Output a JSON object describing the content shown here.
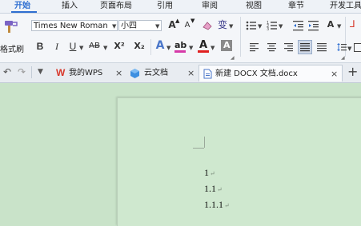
{
  "menu": {
    "tabs": [
      {
        "label": "开始",
        "active": true
      },
      {
        "label": "插入"
      },
      {
        "label": "页面布局"
      },
      {
        "label": "引用"
      },
      {
        "label": "审阅"
      },
      {
        "label": "视图"
      },
      {
        "label": "章节"
      },
      {
        "label": "开发工具"
      }
    ]
  },
  "ribbon": {
    "format_painter_label": "格式刷",
    "font_name": "Times New Roman",
    "font_size": "小四",
    "grow_font": "A",
    "shrink_font": "A",
    "pinyin": "变",
    "bold": "B",
    "italic": "I",
    "underline": "U",
    "strikethrough": "AB",
    "superscript": "X²",
    "subscript": "X₂",
    "text_effect": "A",
    "highlight": "ab",
    "font_color": "A",
    "char_shading": "A",
    "text_dir": "A"
  },
  "tabbar": {
    "tabs": [
      {
        "label": "我的WPS",
        "icon": "wps-logo-icon"
      },
      {
        "label": "云文档",
        "icon": "cloud-docs-icon"
      },
      {
        "label": "新建 DOCX 文档.docx",
        "icon": "document-icon",
        "active": true
      }
    ],
    "new_tab": "+"
  },
  "document": {
    "lines": [
      "1",
      "1.1",
      "1.1.1"
    ],
    "para_mark": "↵"
  },
  "colors": {
    "accent": "#2f6fd1",
    "wps_red": "#d8382b",
    "font_color_red": "#e02020",
    "highlight_magenta": "#d63aa8",
    "doc_background": "#c9e3c9"
  }
}
